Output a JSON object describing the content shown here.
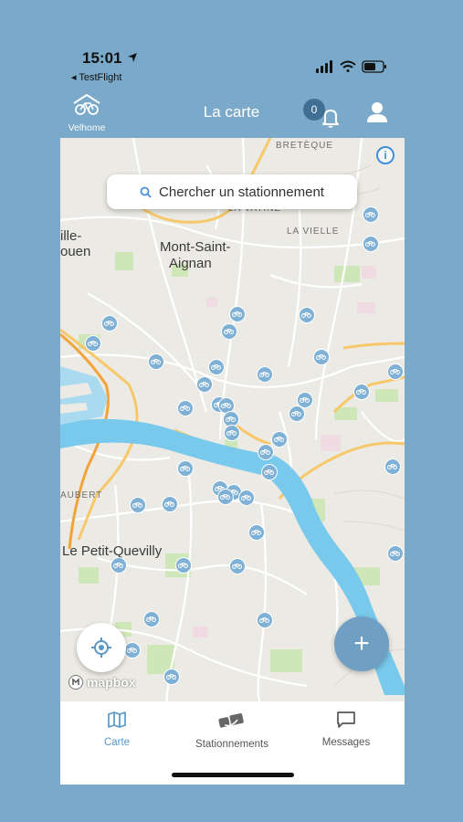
{
  "status_bar": {
    "time": "15:01",
    "back_app": "◂ TestFlight"
  },
  "header": {
    "logo_label": "Velhome",
    "title": "La carte",
    "notification_count": "0",
    "icons": {
      "logo": "bike-house-icon",
      "bell": "bell-icon",
      "profile": "profile-icon"
    }
  },
  "map": {
    "search_placeholder": "Chercher un stationnement",
    "info_label": "i",
    "attribution": "mapbox",
    "places": {
      "mont_saint_aignan_1": "Mont-Saint-",
      "mont_saint_aignan_2": "Aignan",
      "le_petit_quevilly": "Le Petit-Quevilly",
      "ville_1": "ille-",
      "ville_2": "ouen",
      "breteque": "BRETÈQUE",
      "la_vatine": "LA VATINE",
      "la_vielle": "LA VIELLE",
      "aubert": "AUBERT"
    },
    "parking_marker_count": 39,
    "colors": {
      "water": "#aadaf0",
      "river": "#78c9ec",
      "park": "#cfe7b8",
      "marker": "#7fb0d6"
    }
  },
  "buttons": {
    "add_label": "+"
  },
  "tabs": [
    {
      "label": "Carte",
      "icon": "map-icon",
      "active": true
    },
    {
      "label": "Stationnements",
      "icon": "parking-icon",
      "active": false
    },
    {
      "label": "Messages",
      "icon": "message-icon",
      "active": false
    }
  ],
  "colors": {
    "background": "#7aa9c9",
    "active_tab": "#5b97c4",
    "inactive_tab": "#555555"
  }
}
